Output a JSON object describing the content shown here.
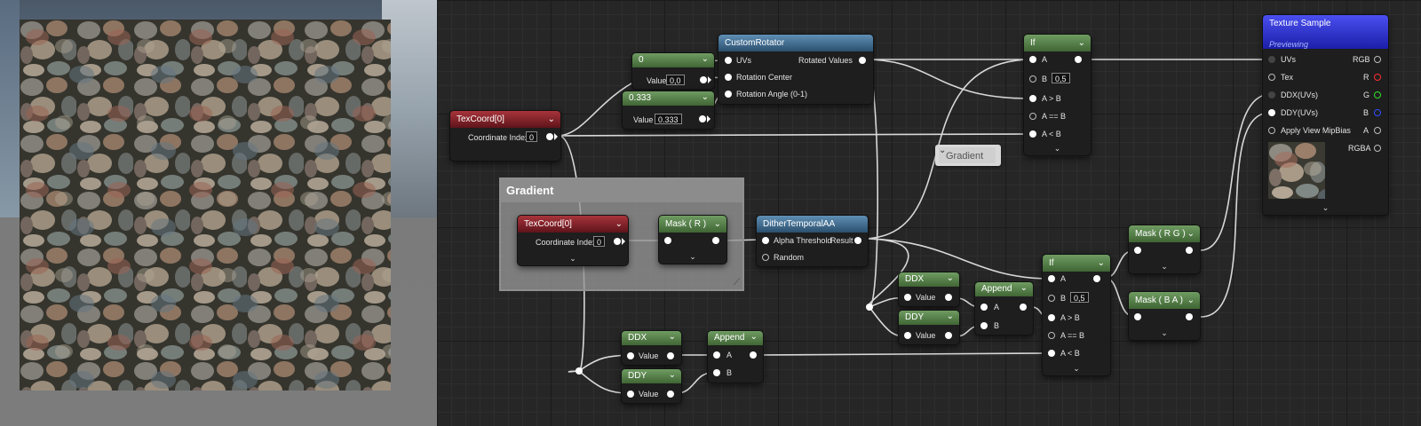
{
  "graph": {
    "nodes": {
      "texcoord_top": {
        "title": "TexCoord[0]",
        "coord_label": "Coordinate Index",
        "coord_value": "0"
      },
      "const_zero": {
        "title": "0",
        "value_label": "Value",
        "value": "0,0"
      },
      "const_0333": {
        "title": "0.333",
        "value_label": "Value",
        "value": "0.333"
      },
      "custom_rotator": {
        "title": "CustomRotator",
        "in_uvs": "UVs",
        "in_rotation_center": "Rotation Center",
        "in_rotation_angle": "Rotation Angle (0-1)",
        "out_rotated_values": "Rotated Values"
      },
      "if_top": {
        "title": "If",
        "a": "A",
        "b": "B",
        "b_value": "0,5",
        "a_gt_b": "A > B",
        "a_eq_b": "A == B",
        "a_lt_b": "A < B"
      },
      "texture_sample": {
        "title": "Texture Sample",
        "subtitle": "Previewing",
        "in_uvs": "UVs",
        "in_tex": "Tex",
        "in_ddx": "DDX(UVs)",
        "in_ddy": "DDY(UVs)",
        "in_mipbias": "Apply View MipBias",
        "out_rgb": "RGB",
        "out_r": "R",
        "out_g": "G",
        "out_b": "B",
        "out_a": "A",
        "out_rgba": "RGBA"
      },
      "texcoord_inner": {
        "title": "TexCoord[0]",
        "coord_label": "Coordinate Index",
        "coord_value": "0"
      },
      "mask_r": {
        "title": "Mask ( R )"
      },
      "dither": {
        "title": "DitherTemporalAA",
        "in_alpha_threshold": "Alpha Threshold",
        "in_random": "Random",
        "out_result": "Result"
      },
      "mask_rg": {
        "title": "Mask ( R G )"
      },
      "mask_ba": {
        "title": "Mask ( B A )"
      },
      "if_bottom": {
        "title": "If",
        "a": "A",
        "b": "B",
        "b_value": "0,5",
        "a_gt_b": "A > B",
        "a_eq_b": "A == B",
        "a_lt_b": "A < B"
      },
      "ddx_mid": {
        "title": "DDX",
        "value_label": "Value"
      },
      "ddy_mid": {
        "title": "DDY",
        "value_label": "Value"
      },
      "append_mid": {
        "title": "Append",
        "a": "A",
        "b": "B"
      },
      "ddx_bot": {
        "title": "DDX",
        "value_label": "Value"
      },
      "ddy_bot": {
        "title": "DDY",
        "value_label": "Value"
      },
      "append_bot": {
        "title": "Append",
        "a": "A",
        "b": "B"
      }
    },
    "comment": {
      "title": "Gradient",
      "bubble": "Gradient"
    }
  },
  "colors": {
    "texture_header": "#2f35d6",
    "param_header": "#4f7f43",
    "texcoord_header": "#8a1f27",
    "function_header": "#44749a",
    "pin_r": "#ff3030",
    "pin_g": "#30e030",
    "pin_b": "#3050ff"
  }
}
